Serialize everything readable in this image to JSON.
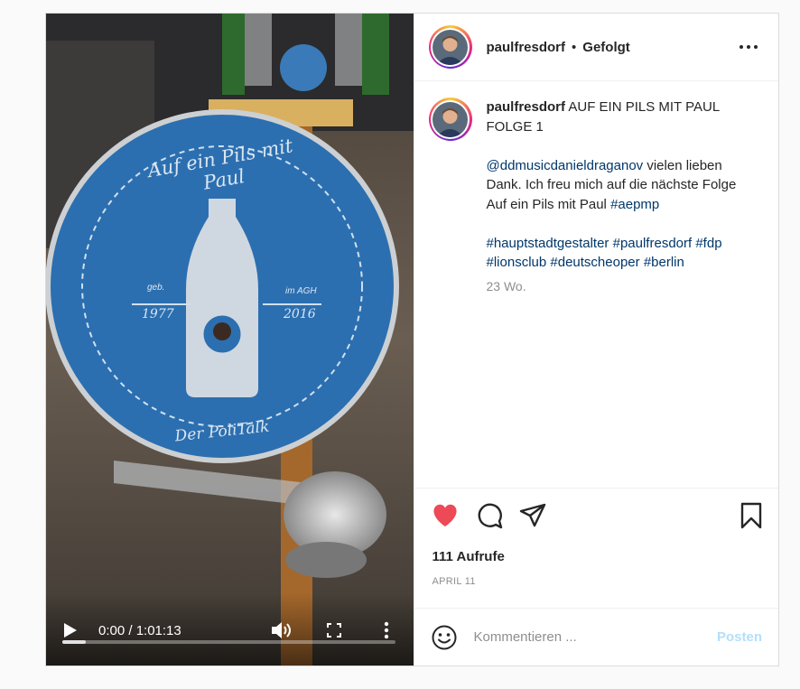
{
  "post": {
    "author": "paulfresdorf",
    "follow_status": "Gefolgt",
    "separator": "•"
  },
  "video": {
    "coaster_top_text": "Auf ein Pils mit Paul",
    "coaster_left_small": "geb.",
    "coaster_left_year": "1977",
    "coaster_right_small": "im AGH",
    "coaster_right_year": "2016",
    "coaster_bottom_text": "Der PoliTalk",
    "time": "0:00 / 1:01:13",
    "progress": 0.07
  },
  "caption": {
    "user": "paulfresdorf",
    "title": "AUF EIN PILS MIT PAUL FOLGE 1",
    "mention": "@ddmusicdanieldraganov",
    "text": "vielen lieben Dank. Ich freu mich auf die nächste Folge Auf ein Pils mit Paul",
    "tag1": "#aepmp",
    "tags": [
      "#hauptstadtgestalter",
      "#paulfresdorf",
      "#fdp",
      "#lionsclub",
      "#deutscheoper",
      "#berlin"
    ],
    "ago": "23 Wo."
  },
  "stats": {
    "views": "111 Aufrufe",
    "date": "APRIL 11"
  },
  "comment": {
    "placeholder": "Kommentieren ...",
    "post_label": "Posten"
  },
  "icons": {
    "like": "heart-icon",
    "comment": "comment-icon",
    "share": "send-icon",
    "save": "bookmark-icon",
    "emoji": "smile-icon",
    "more": "more-icon"
  },
  "colors": {
    "like": "#ed4956",
    "link": "#00376b",
    "post_disabled": "#b2dffc",
    "coaster_blue": "#2c6fb0"
  }
}
